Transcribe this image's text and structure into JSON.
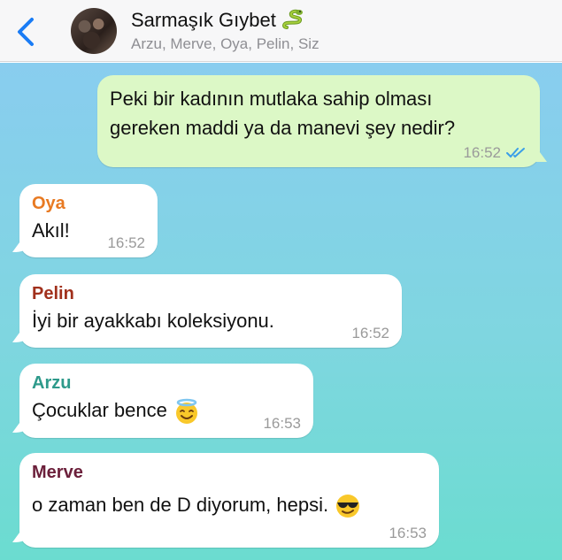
{
  "header": {
    "title": "Sarmaşık Gıybet",
    "title_emoji": "snake-emoji",
    "subtitle": "Arzu, Merve, Oya, Pelin, Siz",
    "accent": "#1a7cf5"
  },
  "messages": [
    {
      "direction": "out",
      "text_line1": "Peki bir kadının mutlaka sahip olması",
      "text_line2": "gereken maddi ya da manevi şey nedir?",
      "time": "16:52",
      "status_icon": "double-check-read-icon"
    },
    {
      "direction": "in",
      "sender": "Oya",
      "sender_color": "#e87a22",
      "text": "Akıl!",
      "time": "16:52"
    },
    {
      "direction": "in",
      "sender": "Pelin",
      "sender_color": "#a1301c",
      "text": "İyi bir ayakkabı koleksiyonu.",
      "time": "16:52"
    },
    {
      "direction": "in",
      "sender": "Arzu",
      "sender_color": "#2e9a8b",
      "text": "Çocuklar bence",
      "emoji": "smiling-face-with-halo-emoji",
      "time": "16:53"
    },
    {
      "direction": "in",
      "sender": "Merve",
      "sender_color": "#6b1f3a",
      "text": "o zaman ben de D diyorum, hepsi.",
      "emoji": "smiling-face-with-sunglasses-emoji",
      "time": "16:53"
    }
  ]
}
